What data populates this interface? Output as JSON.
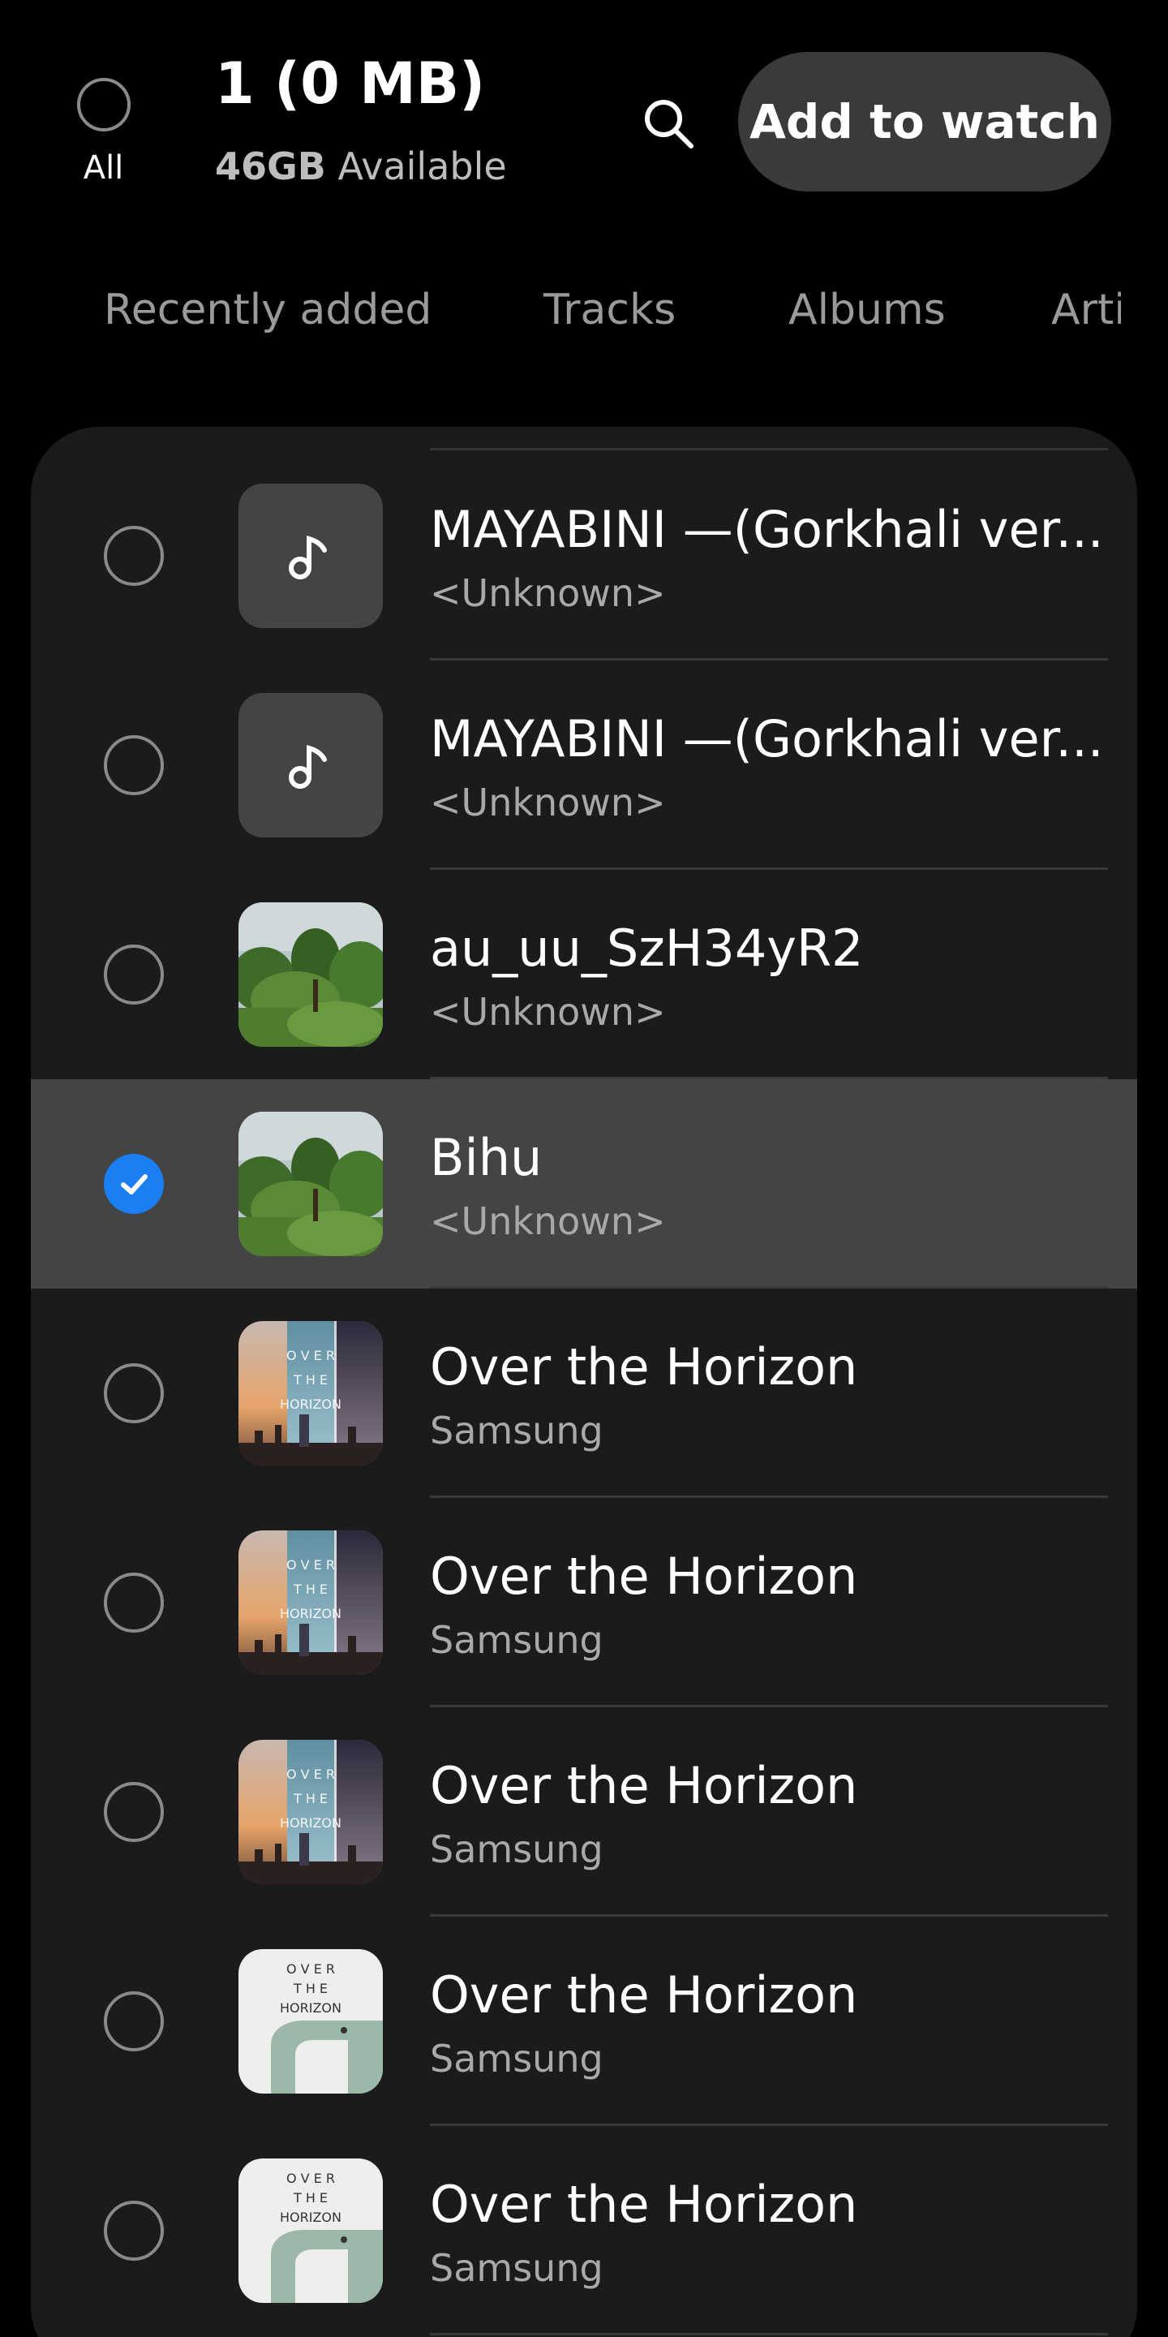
{
  "header": {
    "all_label": "All",
    "selection_count": "1 (0 MB)",
    "storage_amount": "46GB",
    "storage_label": "Available",
    "add_to_watch": "Add to watch",
    "icons": {
      "search": "search-icon"
    }
  },
  "tabs": [
    {
      "label": "Recently added",
      "active": true
    },
    {
      "label": "Tracks",
      "active": false
    },
    {
      "label": "Albums",
      "active": false
    },
    {
      "label": "Arti",
      "active": false
    }
  ],
  "colors": {
    "background": "#000000",
    "card": "#1b1b1b",
    "selected_row": "#444444",
    "accent_check": "#1a7ff2",
    "button": "#3a3a3a"
  },
  "tracks": [
    {
      "title": "MAYABINI —(Gorkhali ver...",
      "artist": "<Unknown>",
      "art": "music-note-icon",
      "selected": false
    },
    {
      "title": "MAYABINI —(Gorkhali ver...",
      "artist": "<Unknown>",
      "art": "music-note-icon",
      "selected": false
    },
    {
      "title": "au_uu_SzH34yR2",
      "artist": "<Unknown>",
      "art": "forest-photo",
      "selected": false
    },
    {
      "title": "Bihu",
      "artist": "<Unknown>",
      "art": "forest-photo",
      "selected": true
    },
    {
      "title": "Over the Horizon",
      "artist": "Samsung",
      "art": "horizon-city-art",
      "selected": false
    },
    {
      "title": "Over the Horizon",
      "artist": "Samsung",
      "art": "horizon-city-art",
      "selected": false
    },
    {
      "title": "Over the Horizon",
      "artist": "Samsung",
      "art": "horizon-city-art",
      "selected": false
    },
    {
      "title": "Over the Horizon",
      "artist": "Samsung",
      "art": "horizon-light-art",
      "selected": false
    },
    {
      "title": "Over the Horizon",
      "artist": "Samsung",
      "art": "horizon-light-art",
      "selected": false
    }
  ],
  "art_text": {
    "line1": "O V E R",
    "line2": "T H E",
    "line3": "HORIZON"
  }
}
